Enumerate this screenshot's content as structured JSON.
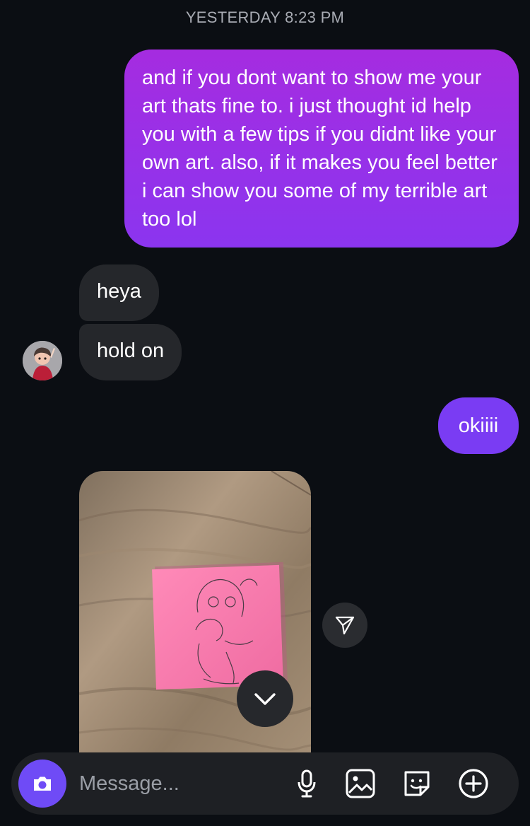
{
  "thread": {
    "timestamp": "YESTERDAY 8:23 PM"
  },
  "messages": [
    {
      "direction": "outgoing",
      "text": "and if you dont want to show me your art thats fine to. i just thought id help you with a few tips if you didnt like your own art. also, if it makes you feel better i can show you some of my terrible art too lol"
    },
    {
      "direction": "incoming",
      "text": "heya"
    },
    {
      "direction": "incoming",
      "text": "hold on"
    },
    {
      "direction": "outgoing",
      "text": "okiiii"
    },
    {
      "direction": "incoming",
      "type": "photo",
      "content": "pink sticky note with pencil drawing on wooden table"
    }
  ],
  "icons": {
    "avatar": "avatar",
    "share": "send-icon",
    "scroll_down": "chevron-down-icon",
    "camera": "camera-icon",
    "microphone": "microphone-icon",
    "gallery": "image-icon",
    "sticker": "sticker-icon",
    "more": "plus-circle-icon"
  },
  "composer": {
    "placeholder": "Message..."
  },
  "colors": {
    "background": "#0b0e13",
    "outgoing_bubble_top": "#a52ce0",
    "outgoing_bubble_bottom": "#8b35ef",
    "outgoing_bubble_short": "#7a3cf3",
    "incoming_bubble": "#25272b",
    "camera_button": "#6f4bf6",
    "composer_bg": "#1e2024"
  }
}
